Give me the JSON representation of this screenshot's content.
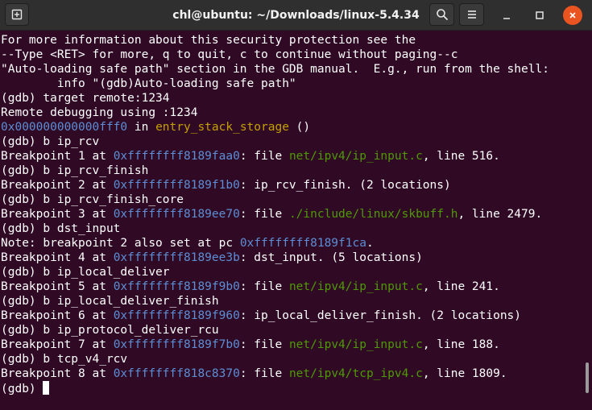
{
  "window": {
    "title": "chl@ubuntu: ~/Downloads/linux-5.4.34"
  },
  "colors": {
    "terminal_bg": "#300a24",
    "text": "#ffffff",
    "address": "#5c8ed6",
    "function": "#c4a000",
    "path": "#4e9a06",
    "close_button": "#e95420"
  },
  "icons": {
    "new_tab": "new-tab-icon",
    "search": "search-icon",
    "menu": "hamburger-menu-icon",
    "minimize": "minimize-icon",
    "maximize": "maximize-icon",
    "close": "close-icon"
  },
  "terminal": {
    "lines": [
      {
        "segments": [
          {
            "t": "For more information about this security protection see the",
            "c": "text"
          }
        ]
      },
      {
        "segments": [
          {
            "t": "--Type <RET> for more, q to quit, c to continue without paging--c",
            "c": "text"
          }
        ]
      },
      {
        "segments": [
          {
            "t": "\"Auto-loading safe path\" section in the GDB manual.  E.g., run from the shell:",
            "c": "text"
          }
        ]
      },
      {
        "segments": [
          {
            "t": "        info \"(gdb)Auto-loading safe path\"",
            "c": "text"
          }
        ]
      },
      {
        "segments": [
          {
            "t": "(gdb) target remote:1234",
            "c": "text"
          }
        ]
      },
      {
        "segments": [
          {
            "t": "Remote debugging using :1234",
            "c": "text"
          }
        ]
      },
      {
        "segments": [
          {
            "t": "0x000000000000fff0",
            "c": "addr"
          },
          {
            "t": " in ",
            "c": "text"
          },
          {
            "t": "entry_stack_storage",
            "c": "func"
          },
          {
            "t": " ()",
            "c": "text"
          }
        ]
      },
      {
        "segments": [
          {
            "t": "(gdb) b ip_rcv",
            "c": "text"
          }
        ]
      },
      {
        "segments": [
          {
            "t": "Breakpoint 1 at ",
            "c": "text"
          },
          {
            "t": "0xffffffff8189faa0",
            "c": "addr"
          },
          {
            "t": ": file ",
            "c": "text"
          },
          {
            "t": "net/ipv4/ip_input.c",
            "c": "path"
          },
          {
            "t": ", line 516.",
            "c": "text"
          }
        ]
      },
      {
        "segments": [
          {
            "t": "(gdb) b ip_rcv_finish",
            "c": "text"
          }
        ]
      },
      {
        "segments": [
          {
            "t": "Breakpoint 2 at ",
            "c": "text"
          },
          {
            "t": "0xffffffff8189f1b0",
            "c": "addr"
          },
          {
            "t": ": ip_rcv_finish. (2 locations)",
            "c": "text"
          }
        ]
      },
      {
        "segments": [
          {
            "t": "(gdb) b ip_rcv_finish_core",
            "c": "text"
          }
        ]
      },
      {
        "segments": [
          {
            "t": "Breakpoint 3 at ",
            "c": "text"
          },
          {
            "t": "0xffffffff8189ee70",
            "c": "addr"
          },
          {
            "t": ": file ",
            "c": "text"
          },
          {
            "t": "./include/linux/skbuff.h",
            "c": "path"
          },
          {
            "t": ", line 2479.",
            "c": "text"
          }
        ]
      },
      {
        "segments": [
          {
            "t": "(gdb) b dst_input",
            "c": "text"
          }
        ]
      },
      {
        "segments": [
          {
            "t": "Note: breakpoint 2 also set at pc ",
            "c": "text"
          },
          {
            "t": "0xffffffff8189f1ca",
            "c": "addr"
          },
          {
            "t": ".",
            "c": "text"
          }
        ]
      },
      {
        "segments": [
          {
            "t": "Breakpoint 4 at ",
            "c": "text"
          },
          {
            "t": "0xffffffff8189ee3b",
            "c": "addr"
          },
          {
            "t": ": dst_input. (5 locations)",
            "c": "text"
          }
        ]
      },
      {
        "segments": [
          {
            "t": "(gdb) b ip_local_deliver",
            "c": "text"
          }
        ]
      },
      {
        "segments": [
          {
            "t": "Breakpoint 5 at ",
            "c": "text"
          },
          {
            "t": "0xffffffff8189f9b0",
            "c": "addr"
          },
          {
            "t": ": file ",
            "c": "text"
          },
          {
            "t": "net/ipv4/ip_input.c",
            "c": "path"
          },
          {
            "t": ", line 241.",
            "c": "text"
          }
        ]
      },
      {
        "segments": [
          {
            "t": "(gdb) b ip_local_deliver_finish",
            "c": "text"
          }
        ]
      },
      {
        "segments": [
          {
            "t": "Breakpoint 6 at ",
            "c": "text"
          },
          {
            "t": "0xffffffff8189f960",
            "c": "addr"
          },
          {
            "t": ": ip_local_deliver_finish. (2 locations)",
            "c": "text"
          }
        ]
      },
      {
        "segments": [
          {
            "t": "(gdb) b ip_protocol_deliver_rcu",
            "c": "text"
          }
        ]
      },
      {
        "segments": [
          {
            "t": "Breakpoint 7 at ",
            "c": "text"
          },
          {
            "t": "0xffffffff8189f7b0",
            "c": "addr"
          },
          {
            "t": ": file ",
            "c": "text"
          },
          {
            "t": "net/ipv4/ip_input.c",
            "c": "path"
          },
          {
            "t": ", line 188.",
            "c": "text"
          }
        ]
      },
      {
        "segments": [
          {
            "t": "(gdb) b tcp_v4_rcv",
            "c": "text"
          }
        ]
      },
      {
        "segments": [
          {
            "t": "Breakpoint 8 at ",
            "c": "text"
          },
          {
            "t": "0xffffffff818c8370",
            "c": "addr"
          },
          {
            "t": ": file ",
            "c": "text"
          },
          {
            "t": "net/ipv4/tcp_ipv4.c",
            "c": "path"
          },
          {
            "t": ", line 1809.",
            "c": "text"
          }
        ]
      }
    ],
    "prompt": "(gdb) "
  }
}
